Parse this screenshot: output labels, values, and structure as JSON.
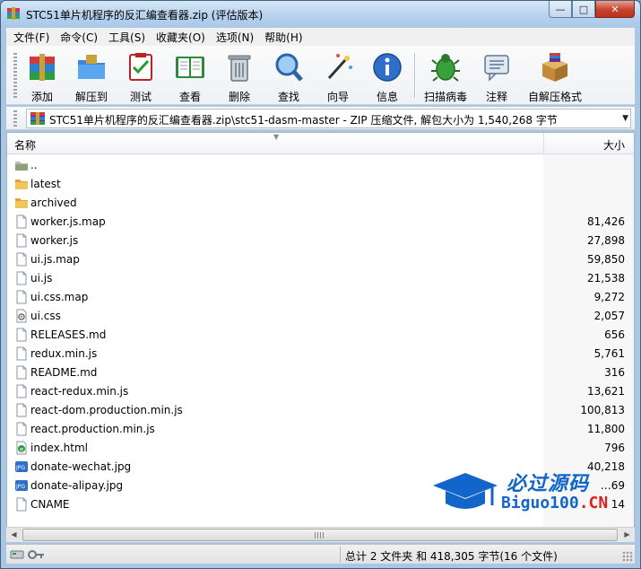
{
  "window": {
    "title": "STC51单片机程序的反汇编查看器.zip (评估版本)",
    "minimize_glyph": "—",
    "maximize_glyph": "□",
    "close_glyph": "✕"
  },
  "menu": [
    "文件(F)",
    "命令(C)",
    "工具(S)",
    "收藏夹(O)",
    "选项(N)",
    "帮助(H)"
  ],
  "toolbar": {
    "buttons": [
      {
        "label": "添加",
        "icon": "add-archive-icon"
      },
      {
        "label": "解压到",
        "icon": "extract-to-icon"
      },
      {
        "label": "测试",
        "icon": "test-icon"
      },
      {
        "label": "查看",
        "icon": "view-book-icon"
      },
      {
        "label": "删除",
        "icon": "trash-icon"
      },
      {
        "label": "查找",
        "icon": "magnifier-icon"
      },
      {
        "label": "向导",
        "icon": "wizard-wand-icon"
      },
      {
        "label": "信息",
        "icon": "info-icon"
      },
      {
        "label": "扫描病毒",
        "icon": "virus-scan-icon"
      },
      {
        "label": "注释",
        "icon": "comment-icon"
      },
      {
        "label": "自解压格式",
        "icon": "sfx-box-icon"
      }
    ]
  },
  "address": {
    "path": "STC51单片机程序的反汇编查看器.zip\\stc51-dasm-master - ZIP 压缩文件, 解包大小为 1,540,268 字节"
  },
  "list": {
    "columns": {
      "name": "名称",
      "size": "大小"
    },
    "files": [
      {
        "name": "..",
        "size": "",
        "type": "up"
      },
      {
        "name": "latest",
        "size": "",
        "type": "folder"
      },
      {
        "name": "archived",
        "size": "",
        "type": "folder"
      },
      {
        "name": "worker.js.map",
        "size": "81,426",
        "type": "file"
      },
      {
        "name": "worker.js",
        "size": "27,898",
        "type": "file"
      },
      {
        "name": "ui.js.map",
        "size": "59,850",
        "type": "file"
      },
      {
        "name": "ui.js",
        "size": "21,538",
        "type": "file"
      },
      {
        "name": "ui.css.map",
        "size": "9,272",
        "type": "file"
      },
      {
        "name": "ui.css",
        "size": "2,057",
        "type": "css"
      },
      {
        "name": "RELEASES.md",
        "size": "656",
        "type": "file"
      },
      {
        "name": "redux.min.js",
        "size": "5,761",
        "type": "file"
      },
      {
        "name": "README.md",
        "size": "316",
        "type": "file"
      },
      {
        "name": "react-redux.min.js",
        "size": "13,621",
        "type": "file"
      },
      {
        "name": "react-dom.production.min.js",
        "size": "100,813",
        "type": "file"
      },
      {
        "name": "react.production.min.js",
        "size": "11,800",
        "type": "file"
      },
      {
        "name": "index.html",
        "size": "796",
        "type": "html"
      },
      {
        "name": "donate-wechat.jpg",
        "size": "40,218",
        "type": "jpg"
      },
      {
        "name": "donate-alipay.jpg",
        "size": "…69",
        "type": "jpg"
      },
      {
        "name": "CNAME",
        "size": "14",
        "type": "file"
      }
    ]
  },
  "status": {
    "text": "总计 2 文件夹 和 418,305 字节(16 个文件)"
  },
  "watermark": {
    "cn": "必过源码",
    "en_main": "Biguo100",
    "en_suffix": ".CN"
  },
  "colors": {
    "accent": "#1265c9",
    "watermark_red": "#e01f1f",
    "folder": "#e7b64a"
  }
}
